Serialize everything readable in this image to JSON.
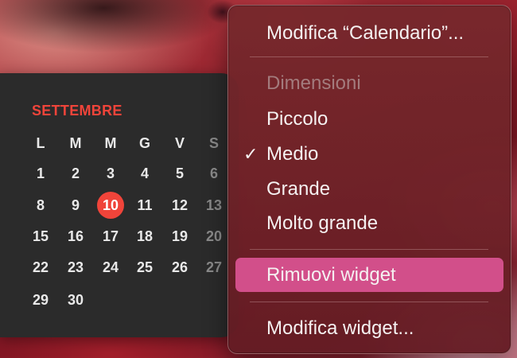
{
  "calendar": {
    "month": "SETTEMBRE",
    "weekdays": [
      "L",
      "M",
      "M",
      "G",
      "V",
      "S"
    ],
    "weeks": [
      [
        "1",
        "2",
        "3",
        "4",
        "5",
        "6"
      ],
      [
        "8",
        "9",
        "10",
        "11",
        "12",
        "13"
      ],
      [
        "15",
        "16",
        "17",
        "18",
        "19",
        "20"
      ],
      [
        "22",
        "23",
        "24",
        "25",
        "26",
        "27"
      ],
      [
        "29",
        "30"
      ]
    ],
    "today": "10",
    "accent_color": "#f0443a"
  },
  "context_menu": {
    "edit_calendar": "Modifica “Calendario”...",
    "size_header": "Dimensioni",
    "sizes": [
      "Piccolo",
      "Medio",
      "Grande",
      "Molto grande"
    ],
    "selected_size": "Medio",
    "checkmark": "✓",
    "remove_widget": "Rimuovi widget",
    "edit_widgets": "Modifica widget...",
    "highlight_color": "#d24f8a"
  }
}
